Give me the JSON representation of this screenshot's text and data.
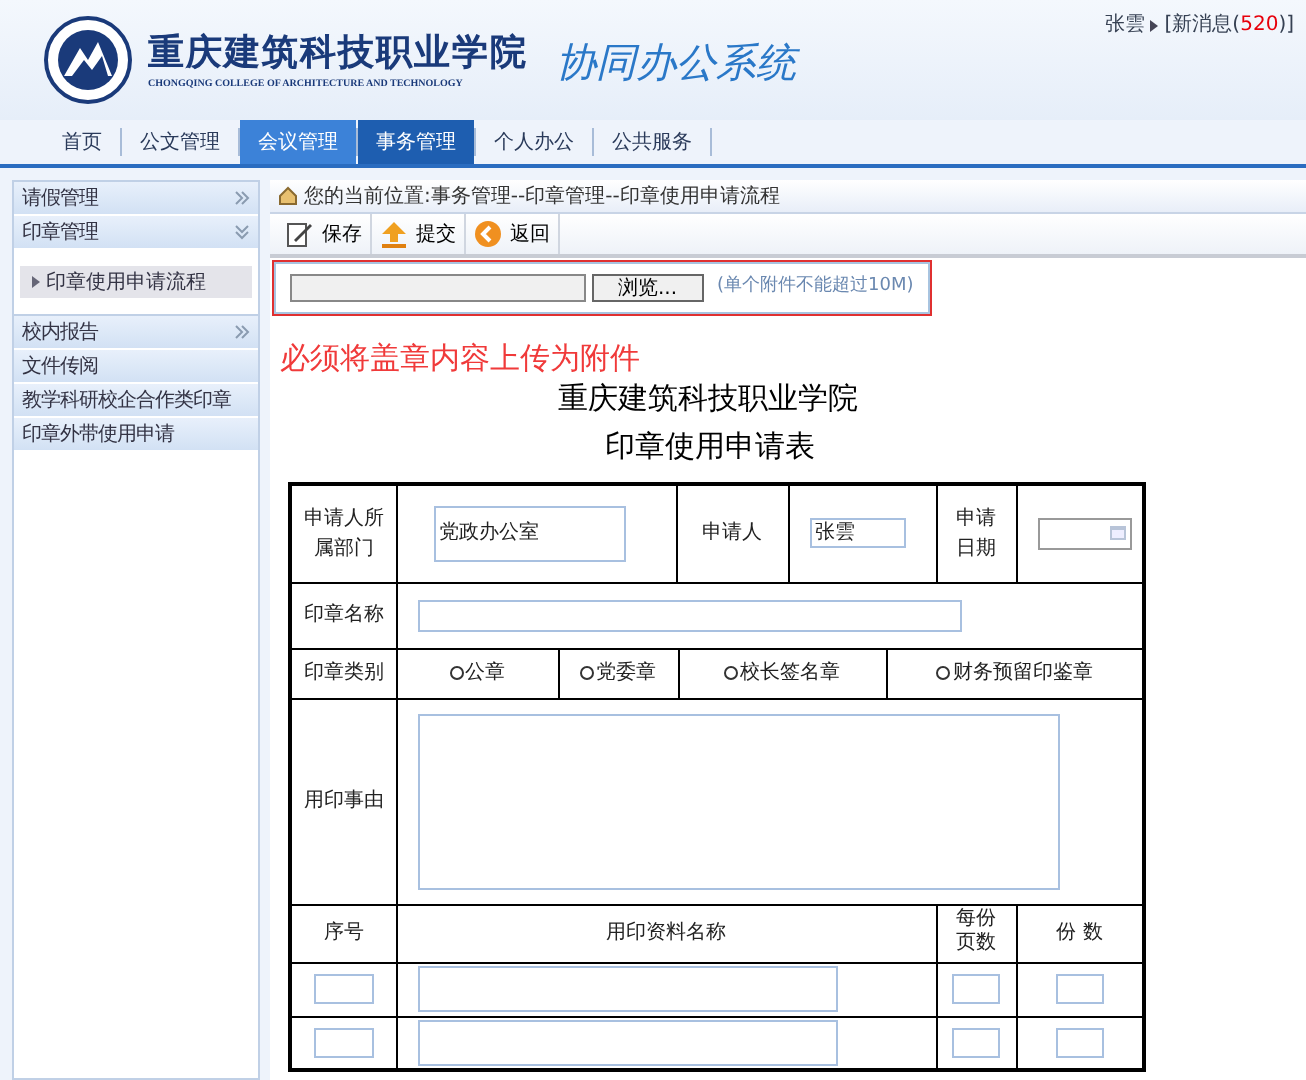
{
  "header": {
    "school_name": "重庆建筑科技职业学院",
    "school_name_en": "CHONGQING COLLEGE OF ARCHITECTURE AND TECHNOLOGY",
    "system_title": "协同办公系统",
    "user": "张雲",
    "messages_label": "[新消息(",
    "messages_count": "520",
    "messages_end": ")]"
  },
  "nav": [
    {
      "label": "首页",
      "selected": false,
      "hovered": false
    },
    {
      "label": "公文管理",
      "selected": false,
      "hovered": false
    },
    {
      "label": "会议管理",
      "selected": false,
      "hovered": true
    },
    {
      "label": "事务管理",
      "selected": true,
      "hovered": false
    },
    {
      "label": "个人办公",
      "selected": false,
      "hovered": false
    },
    {
      "label": "公共服务",
      "selected": false,
      "hovered": false
    }
  ],
  "sidebar": {
    "items": [
      {
        "label": "请假管理",
        "kind": "section",
        "expanded": false
      },
      {
        "label": "印章管理",
        "kind": "section",
        "expanded": true,
        "children": [
          {
            "label": "印章使用申请流程",
            "selected": true
          }
        ]
      },
      {
        "label": "校内报告",
        "kind": "section",
        "expanded": false
      },
      {
        "label": "文件传阅",
        "kind": "link"
      },
      {
        "label": "教学科研校企合作类印章",
        "kind": "link"
      },
      {
        "label": "印章外带使用申请",
        "kind": "link"
      }
    ]
  },
  "breadcrumb": "您的当前位置:事务管理--印章管理--印章使用申请流程",
  "toolbar": [
    {
      "label": "保存",
      "kind": "save"
    },
    {
      "label": "提交",
      "kind": "submit"
    },
    {
      "label": "返回",
      "kind": "back"
    }
  ],
  "upload": {
    "button": "浏览...",
    "hint": "(单个附件不能超过10M)"
  },
  "warning": "必须将盖章内容上传为附件",
  "form": {
    "org": "重庆建筑科技职业学院",
    "title": "印章使用申请表",
    "department_label": "申请人所属部门",
    "department": "党政办公室",
    "applicant_label": "申请人",
    "applicant": "张雲",
    "date_label": "申请日期",
    "seal_name_label": "印章名称",
    "seal_type_label": "印章类别",
    "seal_types": [
      {
        "label": "公章",
        "selected": false
      },
      {
        "label": "党委章",
        "selected": false
      },
      {
        "label": "校长签名章",
        "selected": false
      },
      {
        "label": "财务预留印鉴章",
        "selected": false
      }
    ],
    "reason_label": "用印事由",
    "columns": [
      "序号",
      "用印资料名称",
      "每份页数",
      "份 数"
    ]
  }
}
